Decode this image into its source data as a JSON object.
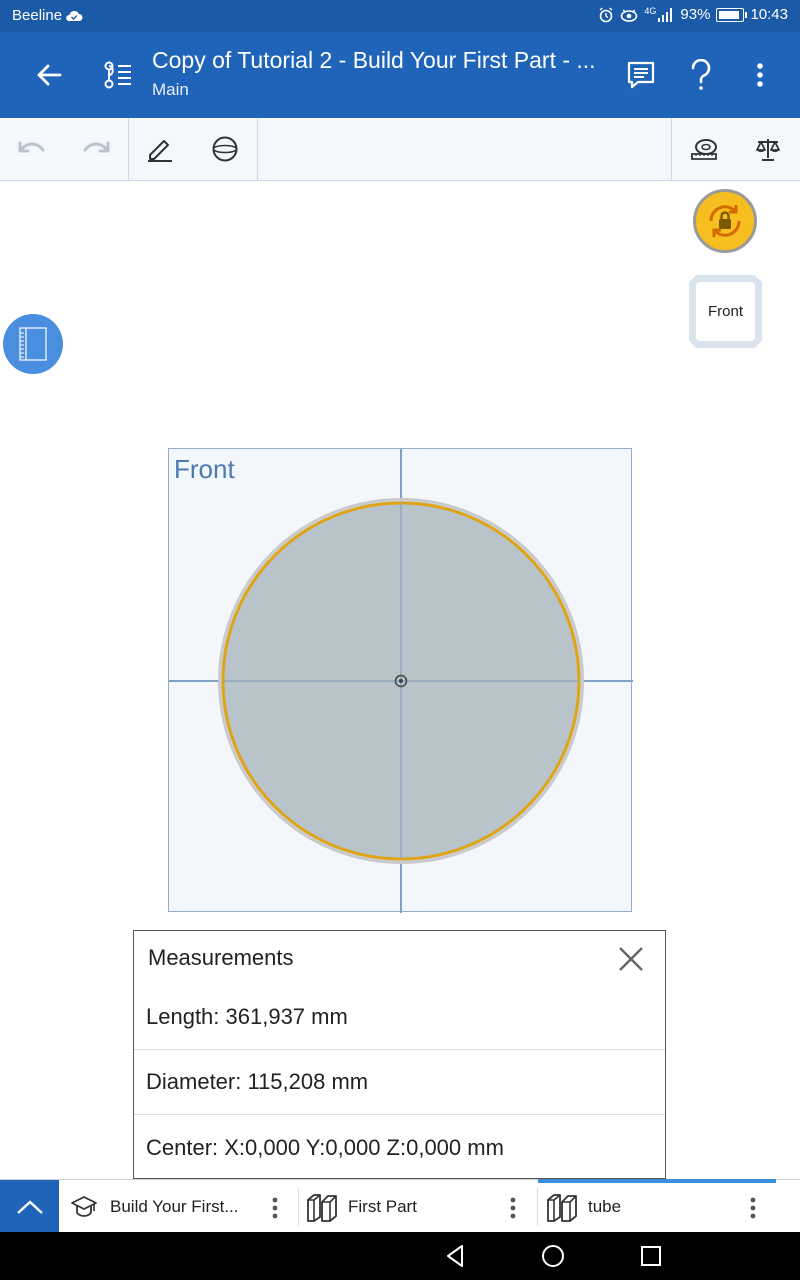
{
  "status_bar": {
    "carrier": "Beeline",
    "network": "4G",
    "battery": "93%",
    "time": "10:43"
  },
  "app_bar": {
    "title": "Copy of Tutorial 2 - Build Your First Part - ...",
    "subtitle": "Main"
  },
  "viewcube": {
    "face_label": "Front"
  },
  "sketch": {
    "plane_label": "Front"
  },
  "measurements": {
    "title": "Measurements",
    "rows": [
      "Length: 361,937 mm",
      "Diameter: 115,208 mm",
      "Center: X:0,000 Y:0,000 Z:0,000 mm"
    ]
  },
  "tabs": [
    {
      "label": "Build Your First...",
      "icon": "graduation-cap-icon"
    },
    {
      "label": "First Part",
      "icon": "part-studio-icon"
    },
    {
      "label": "tube",
      "icon": "part-studio-icon",
      "active": true
    }
  ],
  "colors": {
    "app_bar": "#1f64b8",
    "status_bar": "#1a5aa6",
    "lock_button": "#f6bf1f",
    "selection_outline": "#e0a417"
  }
}
